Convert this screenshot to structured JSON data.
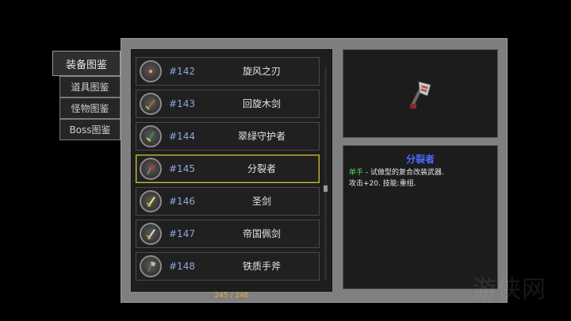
{
  "tabs": [
    {
      "label": "装备图鉴",
      "active": true
    },
    {
      "label": "道具图鉴",
      "active": false
    },
    {
      "label": "怪物图鉴",
      "active": false
    },
    {
      "label": "Boss图鉴",
      "active": false
    }
  ],
  "list": [
    {
      "number": "#142",
      "name": "旋风之刃",
      "icon": "whirlwind-blade-icon"
    },
    {
      "number": "#143",
      "name": "回旋木剑",
      "icon": "wooden-boomerang-sword-icon"
    },
    {
      "number": "#144",
      "name": "翠绿守护者",
      "icon": "emerald-guardian-icon"
    },
    {
      "number": "#145",
      "name": "分裂者",
      "icon": "splitter-axe-icon",
      "selected": true
    },
    {
      "number": "#146",
      "name": "圣剑",
      "icon": "holy-sword-icon"
    },
    {
      "number": "#147",
      "name": "帝国佩剑",
      "icon": "imperial-sword-icon"
    },
    {
      "number": "#148",
      "name": "铁质手斧",
      "icon": "iron-hatchet-icon"
    }
  ],
  "counter": "245 / 246",
  "detail": {
    "title": "分裂者",
    "hand": "单手",
    "line1": " - 试做型的复合改装武器.",
    "line2": "攻击+20. 技能:重组.",
    "preview_icon": "splitter-axe-icon"
  },
  "watermark": "游侠网",
  "colors": {
    "number": "#8fa6dc",
    "selected_border": "#c8be3c",
    "title": "#4a6cff",
    "hand": "#4fd45a",
    "counter": "#e0b23a"
  }
}
